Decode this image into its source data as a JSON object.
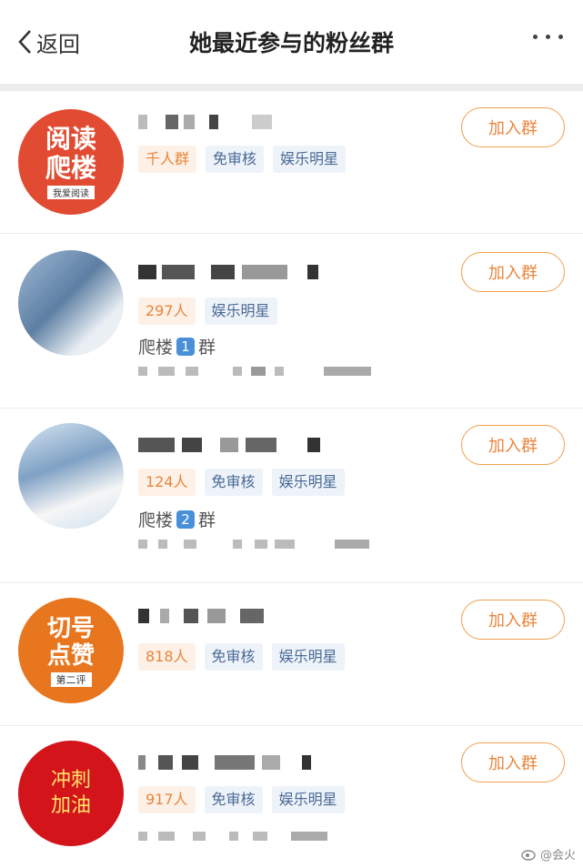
{
  "header": {
    "back_label": "返回",
    "title": "她最近参与的粉丝群"
  },
  "groups": [
    {
      "avatar_lines": [
        "阅读",
        "爬楼"
      ],
      "avatar_small": "我爱阅读",
      "tags": [
        "千人群",
        "免审核",
        "娱乐明星"
      ],
      "join_label": "加入群"
    },
    {
      "tags": [
        "297人",
        "娱乐明星"
      ],
      "sub_prefix": "爬楼",
      "sub_badge": "1",
      "sub_suffix": "群",
      "join_label": "加入群"
    },
    {
      "tags": [
        "124人",
        "免审核",
        "娱乐明星"
      ],
      "sub_prefix": "爬楼",
      "sub_badge": "2",
      "sub_suffix": "群",
      "join_label": "加入群"
    },
    {
      "avatar_lines": [
        "切号",
        "点赞"
      ],
      "avatar_small": "第二评",
      "tags": [
        "818人",
        "免审核",
        "娱乐明星"
      ],
      "join_label": "加入群"
    },
    {
      "avatar_lines": [
        "冲刺",
        "加油"
      ],
      "tags": [
        "917人",
        "免审核",
        "娱乐明星"
      ],
      "join_label": "加入群"
    }
  ],
  "watermark": "@会火",
  "colors": {
    "accent": "#e8863c",
    "tag_feature": "#4a6a95"
  }
}
